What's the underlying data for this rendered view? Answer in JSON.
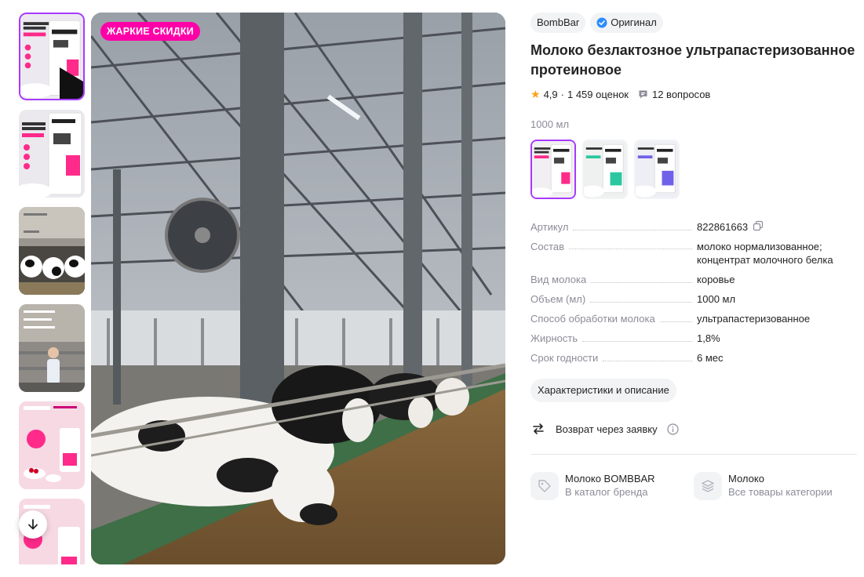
{
  "promo_badge": "ЖАРКИЕ СКИДКИ",
  "brand": "BombBar",
  "original_badge": "Оригинал",
  "product_title": "Молоко безлактозное ультрапастеризованное протеиновое",
  "rating": "4,9",
  "rating_separator": "·",
  "ratings_count": "1 459 оценок",
  "questions": "12 вопросов",
  "volume_label": "1000 мл",
  "specs": [
    {
      "key": "Артикул",
      "value": "822861663"
    },
    {
      "key": "Состав",
      "value": "молоко нормализованное; концентрат молочного белка"
    },
    {
      "key": "Вид молока",
      "value": "коровье"
    },
    {
      "key": "Объем (мл)",
      "value": "1000 мл"
    },
    {
      "key": "Способ обработки молока",
      "value": "ультрапастеризованное"
    },
    {
      "key": "Жирность",
      "value": "1,8%"
    },
    {
      "key": "Срок годности",
      "value": "6 мес"
    }
  ],
  "details_button": "Характеристики и описание",
  "return_text": "Возврат через заявку",
  "brand_link": {
    "title": "Молоко BOMBBAR",
    "subtitle": "В каталог бренда"
  },
  "category_link": {
    "title": "Молоко",
    "subtitle": "Все товары категории"
  },
  "colors": {
    "accent": "#a73afd",
    "promo": "#ff00a8",
    "star": "#ff9f1a",
    "muted": "#8c8c99"
  }
}
